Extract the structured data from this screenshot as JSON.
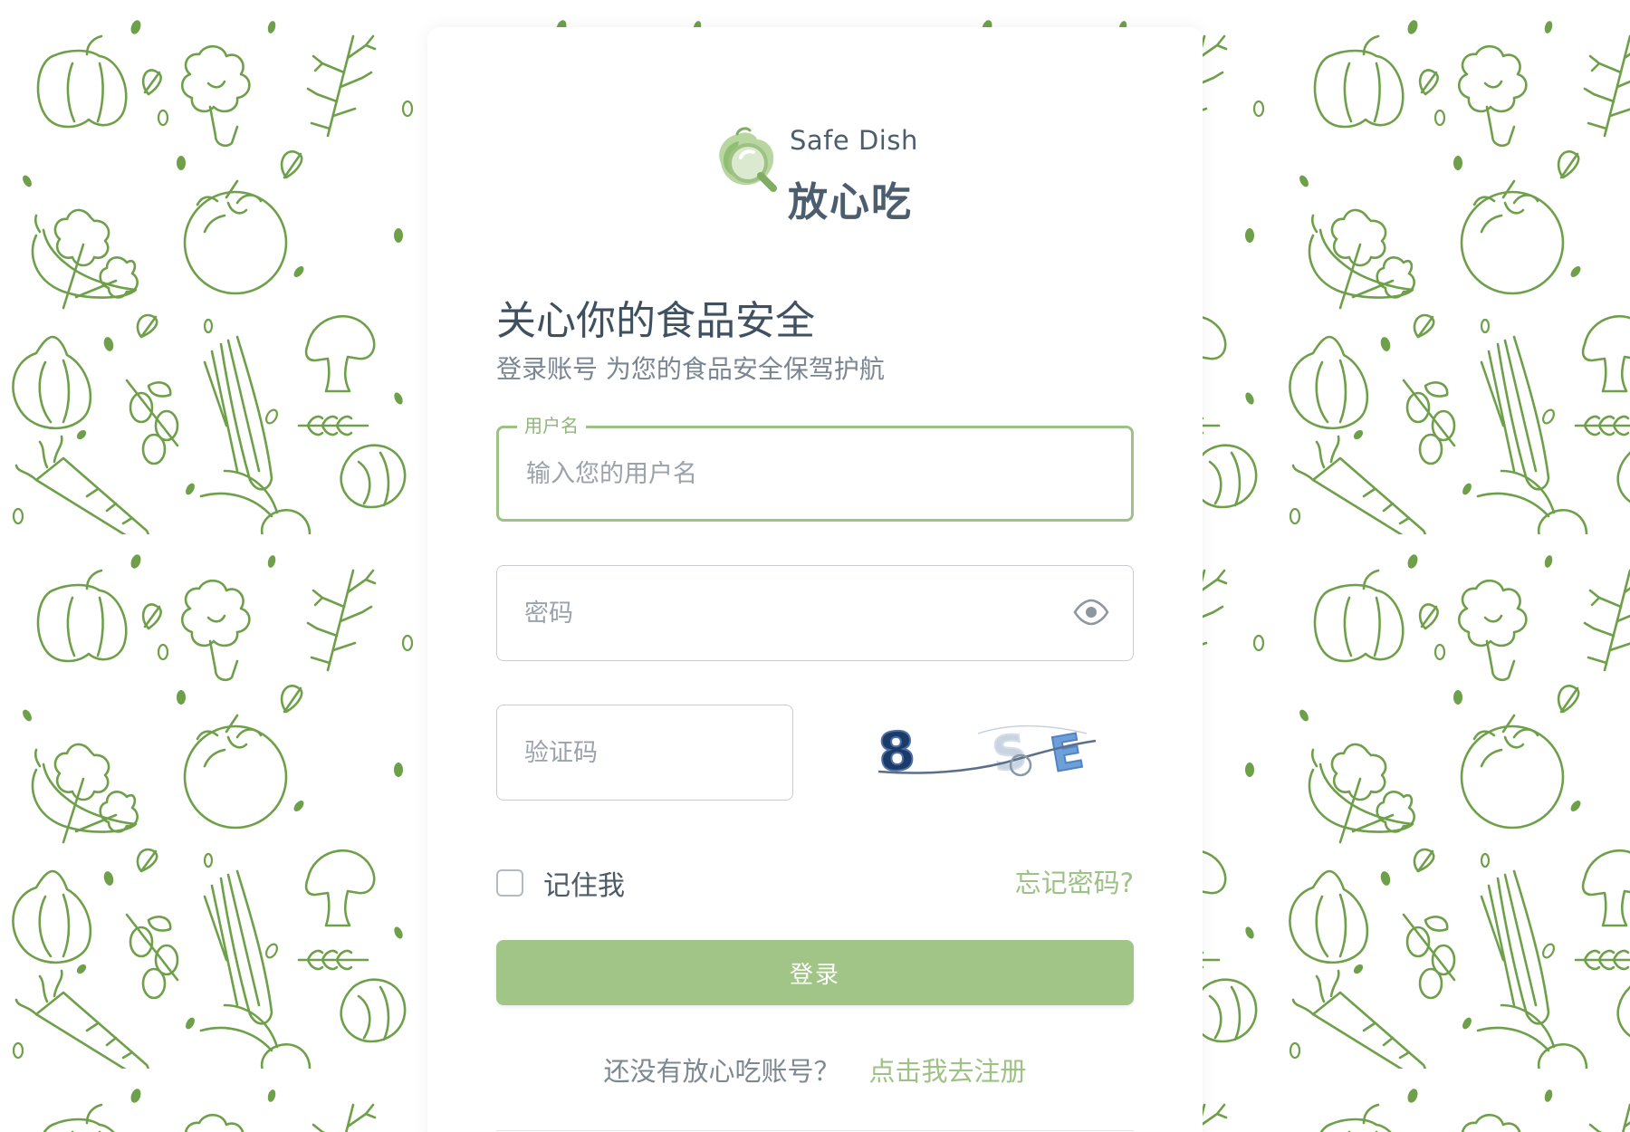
{
  "brand": {
    "name_en": "Safe Dish",
    "name_cn": "放心吃",
    "logo_icon": "leaf-magnifier-icon"
  },
  "hero": {
    "headline": "关心你的食品安全",
    "subline": "登录账号 为您的食品安全保驾护航"
  },
  "form": {
    "username": {
      "label": "用户名",
      "placeholder": "输入您的用户名",
      "value": ""
    },
    "password": {
      "placeholder": "密码",
      "value": "",
      "toggle_icon": "eye-icon"
    },
    "captcha": {
      "placeholder": "验证码",
      "value": "",
      "image_text": "8 S E"
    },
    "remember_label": "记住我",
    "remember_checked": false,
    "forgot_label": "忘记密码?",
    "submit_label": "登录"
  },
  "register": {
    "prompt": "还没有放心吃账号？",
    "link": "点击我去注册"
  },
  "colors": {
    "accent": "#9ec185",
    "button": "#a0c586",
    "pattern": "#6ea04a",
    "text_dark": "#3f5160",
    "text_muted": "#7a8691"
  },
  "background": {
    "pattern": "vegetable-line-art"
  }
}
